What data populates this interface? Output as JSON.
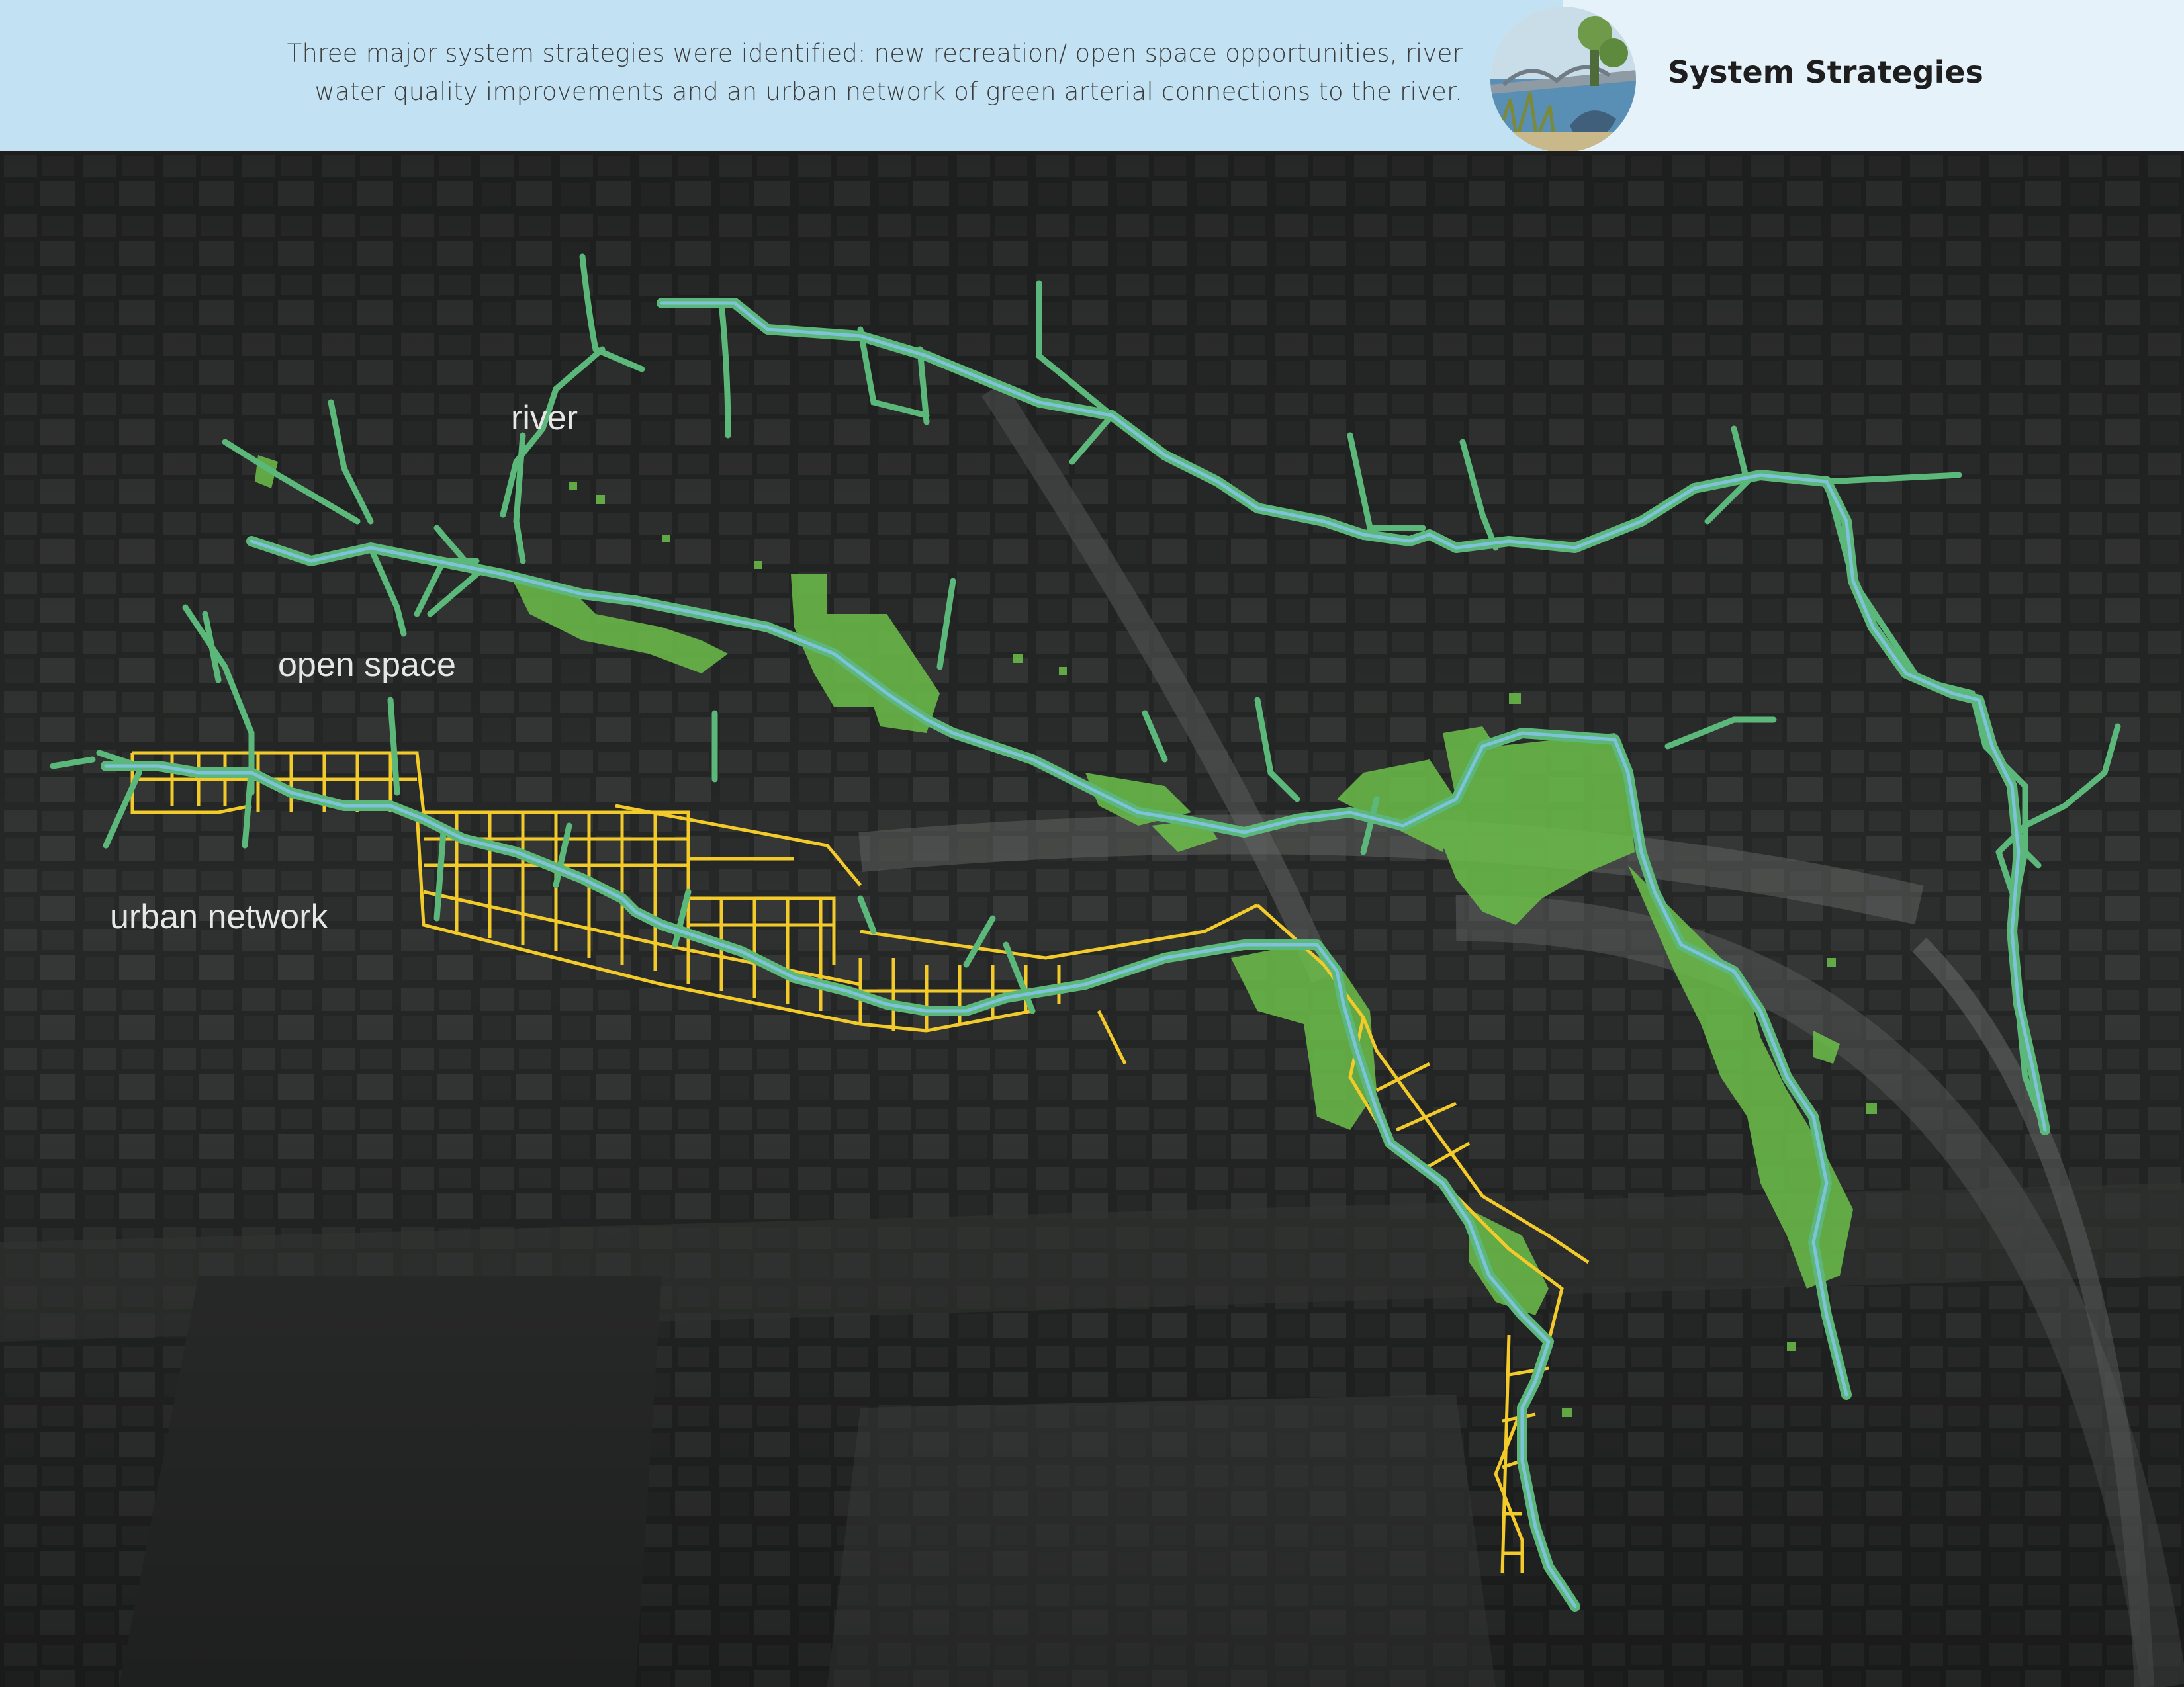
{
  "header": {
    "description_line1": "Three major system strategies were identified: new recreation/ open space opportunities, river",
    "description_line2": "water quality improvements and an urban network of green arterial connections to the river.",
    "title": "System Strategies",
    "logo_icon": "river-bridge-illustration-icon"
  },
  "map": {
    "labels": {
      "river": "river",
      "open_space": "open space",
      "urban_network": "urban network"
    },
    "colors": {
      "river": "#7ec3d9",
      "tributary": "#5cb87a",
      "open_space": "#6cc04a",
      "urban_network": "#f2cb2a",
      "background": "#2a2c2b"
    }
  }
}
